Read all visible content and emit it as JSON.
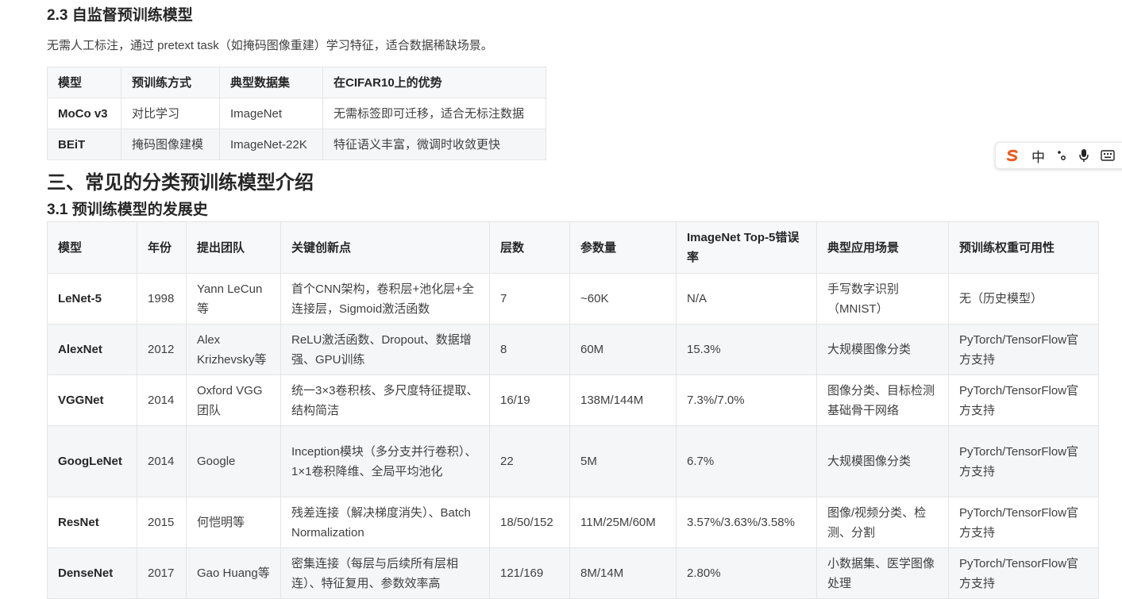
{
  "section23": {
    "heading": "2.3 自监督预训练模型",
    "description": "无需人工标注，通过 pretext task（如掩码图像重建）学习特征，适合数据稀缺场景。",
    "table": {
      "headers": [
        "模型",
        "预训练方式",
        "典型数据集",
        "在CIFAR10上的优势"
      ],
      "rows": [
        [
          "MoCo v3",
          "对比学习",
          "ImageNet",
          "无需标签即可迁移，适合无标注数据"
        ],
        [
          "BEiT",
          "掩码图像建模",
          "ImageNet-22K",
          "特征语义丰富，微调时收敛更快"
        ]
      ]
    }
  },
  "section3": {
    "heading": "三、常见的分类预训练模型介绍",
    "sub_heading": "3.1 预训练模型的发展史",
    "table": {
      "headers": [
        "模型",
        "年份",
        "提出团队",
        "关键创新点",
        "层数",
        "参数量",
        "ImageNet Top-5错误率",
        "典型应用场景",
        "预训练权重可用性"
      ],
      "rows": [
        [
          "LeNet-5",
          "1998",
          "Yann LeCun等",
          "首个CNN架构，卷积层+池化层+全连接层，Sigmoid激活函数",
          "7",
          "~60K",
          "N/A",
          "手写数字识别（MNIST）",
          "无（历史模型）"
        ],
        [
          "AlexNet",
          "2012",
          "Alex Krizhevsky等",
          "ReLU激活函数、Dropout、数据增强、GPU训练",
          "8",
          "60M",
          "15.3%",
          "大规模图像分类",
          "PyTorch/TensorFlow官方支持"
        ],
        [
          "VGGNet",
          "2014",
          "Oxford VGG团队",
          "统一3×3卷积核、多尺度特征提取、结构简洁",
          "16/19",
          "138M/144M",
          "7.3%/7.0%",
          "图像分类、目标检测基础骨干网络",
          "PyTorch/TensorFlow官方支持"
        ],
        [
          "GoogLeNet",
          "2014",
          "Google",
          "Inception模块（多分支并行卷积）、1×1卷积降维、全局平均池化",
          "22",
          "5M",
          "6.7%",
          "大规模图像分类",
          "PyTorch/TensorFlow官方支持"
        ],
        [
          "ResNet",
          "2015",
          "何恺明等",
          "残差连接（解决梯度消失）、Batch Normalization",
          "18/50/152",
          "11M/25M/60M",
          "3.57%/3.63%/3.58%",
          "图像/视频分类、检测、分割",
          "PyTorch/TensorFlow官方支持"
        ],
        [
          "DenseNet",
          "2017",
          "Gao Huang等",
          "密集连接（每层与后续所有层相连）、特征复用、参数效率高",
          "121/169",
          "8M/14M",
          "2.80%",
          "小数据集、医学图像处理",
          "PyTorch/TensorFlow官方支持"
        ]
      ]
    }
  },
  "ime_toolbar": {
    "logo_icon": "sogou-s-icon",
    "lang": "中",
    "punct_icon": "punctuation-icon",
    "mic_icon": "microphone-icon",
    "keyboard_icon": "keyboard-icon",
    "accent": "#f25a1c"
  }
}
